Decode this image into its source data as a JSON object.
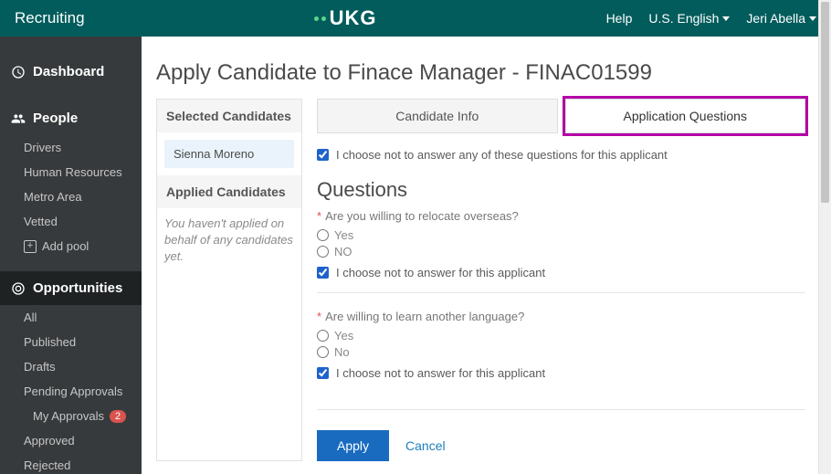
{
  "header": {
    "brand": "Recruiting",
    "logo_text": "UKG",
    "menu": {
      "help": "Help",
      "locale": "U.S. English",
      "user": "Jeri Abella"
    }
  },
  "sidebar": {
    "dashboard": "Dashboard",
    "people": {
      "label": "People",
      "items": [
        "Drivers",
        "Human Resources",
        "Metro Area",
        "Vetted"
      ],
      "add_pool": "Add pool"
    },
    "opportunities": {
      "label": "Opportunities",
      "items": [
        "All",
        "Published",
        "Drafts",
        "Pending Approvals",
        "My Approvals",
        "Approved",
        "Rejected"
      ],
      "my_approvals_badge": "2"
    }
  },
  "page": {
    "title": "Apply Candidate to Finace Manager - FINAC01599",
    "selected_head": "Selected Candidates",
    "selected_candidate": "Sienna Moreno",
    "applied_head": "Applied Candidates",
    "applied_empty": "You haven't applied on behalf of any candidates yet.",
    "tabs": {
      "info": "Candidate Info",
      "questions": "Application Questions"
    },
    "skip_all": "I choose not to answer any of these questions for this applicant",
    "questions_heading": "Questions",
    "skip_one": "I choose not to answer for this applicant",
    "q1": {
      "text": "Are you willing to relocate overseas?",
      "opts": [
        "Yes",
        "NO"
      ]
    },
    "q2": {
      "text": "Are willing to learn another language?",
      "opts": [
        "Yes",
        "No"
      ]
    },
    "actions": {
      "apply": "Apply",
      "cancel": "Cancel"
    }
  }
}
